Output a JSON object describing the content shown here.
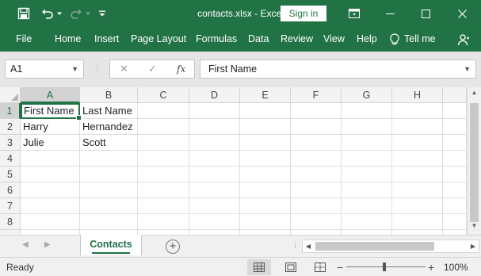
{
  "window": {
    "title": "contacts.xlsx - Excel",
    "sign_in_label": "Sign in"
  },
  "quick_access": {
    "icons": [
      "save-icon",
      "undo-icon",
      "undo-dropdown-icon",
      "redo-icon",
      "redo-dropdown-icon",
      "customize-icon"
    ]
  },
  "window_controls": {
    "icons": [
      "ribbon-display-icon",
      "minimize-icon",
      "maximize-icon",
      "close-icon"
    ]
  },
  "ribbon": {
    "tabs": [
      {
        "label": "File"
      },
      {
        "label": "Home"
      },
      {
        "label": "Insert"
      },
      {
        "label": "Page Layout"
      },
      {
        "label": "Formulas"
      },
      {
        "label": "Data"
      },
      {
        "label": "Review"
      },
      {
        "label": "View"
      },
      {
        "label": "Help"
      },
      {
        "label": "Tell me"
      }
    ],
    "tell_me_icon": "lightbulb-icon",
    "share_icon": "share-icon"
  },
  "formula_bar": {
    "name_box": "A1",
    "fx_symbol": "fx",
    "cancel_glyph": "✕",
    "enter_glyph": "✓",
    "content": "First Name"
  },
  "sheet": {
    "columns": [
      "A",
      "B",
      "C",
      "D",
      "E",
      "F",
      "G",
      "H"
    ],
    "rows": [
      "1",
      "2",
      "3",
      "4",
      "5",
      "6",
      "7",
      "8"
    ],
    "active_cell": "A1",
    "cells": [
      [
        "First Name",
        "Last Name"
      ],
      [
        "Harry",
        "Hernandez"
      ],
      [
        "Julie",
        "Scott"
      ]
    ]
  },
  "sheet_tabs": {
    "tabs": [
      {
        "label": "Contacts",
        "active": true
      }
    ],
    "add_sheet_glyph": "+"
  },
  "status_bar": {
    "status": "Ready",
    "zoom": "100%",
    "zoom_minus": "−",
    "zoom_plus": "+",
    "views": [
      "normal-view-icon",
      "page-layout-view-icon",
      "page-break-view-icon"
    ]
  },
  "colors": {
    "brand": "#217346",
    "grid_line": "#dedede",
    "header_bg": "#f3f3f3"
  }
}
